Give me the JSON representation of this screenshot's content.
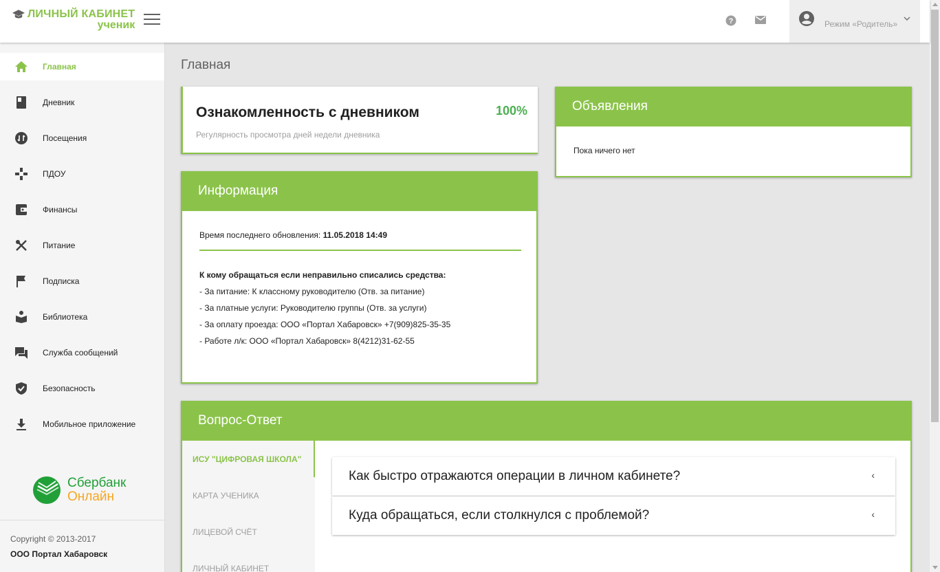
{
  "header": {
    "logo_line1": "ЛИЧНЫЙ КАБИНЕТ",
    "logo_line2": "ученик",
    "user_mode": "Режим «Родитель»"
  },
  "sidebar": {
    "items": [
      {
        "label": "Главная",
        "icon": "home-icon"
      },
      {
        "label": "Дневник",
        "icon": "diary-icon"
      },
      {
        "label": "Посещения",
        "icon": "attendance-icon"
      },
      {
        "label": "ПДОУ",
        "icon": "gamepad-icon"
      },
      {
        "label": "Финансы",
        "icon": "wallet-icon"
      },
      {
        "label": "Питание",
        "icon": "food-icon"
      },
      {
        "label": "Подписка",
        "icon": "flag-icon"
      },
      {
        "label": "Библиотека",
        "icon": "library-icon"
      },
      {
        "label": "Служба сообщений",
        "icon": "chat-icon"
      },
      {
        "label": "Безопасность",
        "icon": "shield-icon"
      },
      {
        "label": "Мобильное приложение",
        "icon": "download-icon"
      }
    ],
    "sber_line1": "Сбербанк",
    "sber_line2": "Онлайн",
    "copyright": "Copyright © 2013-2017",
    "company": "ООО Портал Хабаровск"
  },
  "main": {
    "page_title": "Главная",
    "familiar": {
      "title": "Ознакомленность с дневником",
      "percent": "100%",
      "subtitle": "Регулярность просмотра дней недели дневника"
    },
    "info": {
      "title": "Информация",
      "update_label": "Время последнего обновления:",
      "update_value": "11.05.2018 14:49",
      "contacts_title": "К кому обращаться если неправильно списались средства:",
      "contacts": [
        "- За питание: К классному руководителю (Отв. за питание)",
        "- За платные услуги: Руководителю группы (Отв. за услуги)",
        "- За оплату проезда: ООО «Портал Хабаровск» +7(909)825-35-35",
        "- Работе л/к: ООО «Портал Хабаровск» 8(4212)31-62-55"
      ]
    },
    "ads": {
      "title": "Объявления",
      "empty": "Пока ничего нет"
    },
    "faq": {
      "title": "Вопрос-Ответ",
      "tabs": [
        "ИСУ \"ЦИФРОВАЯ ШКОЛА\"",
        "КАРТА УЧЕНИКА",
        "ЛИЦЕВОЙ СЧЁТ",
        "ЛИЧНЫЙ КАБИНЕТ"
      ],
      "questions": [
        "Как быстро отражаются операции в личном кабинете?",
        "Куда обращаться, если столкнулся с проблемой?"
      ]
    }
  },
  "colors": {
    "accent": "#8bc34a",
    "percent": "#4caf50"
  }
}
